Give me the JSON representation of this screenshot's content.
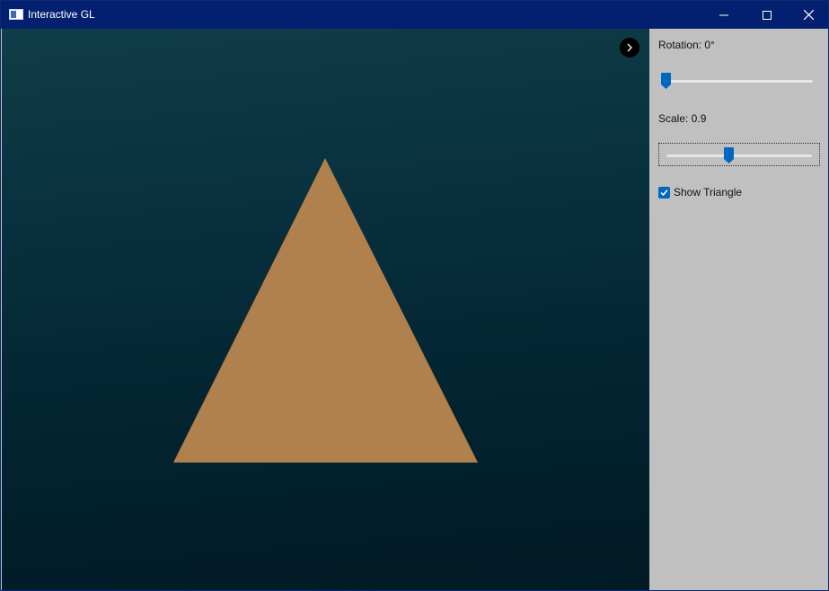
{
  "window": {
    "title": "Interactive GL",
    "title_bar_color": "#032070"
  },
  "titlebar_buttons": {
    "minimize_icon": "minimize-icon",
    "maximize_icon": "maximize-icon",
    "close_icon": "close-icon"
  },
  "viewport": {
    "triangle_color": "#b0804d",
    "expand_icon": "chevron-right-icon"
  },
  "panel": {
    "rotation_label": "Rotation: 0°",
    "rotation_value": 0,
    "rotation_range": [
      0,
      360
    ],
    "scale_label": "Scale: 0.9",
    "scale_value": 0.9,
    "scale_range": [
      0.1,
      2.0
    ],
    "show_triangle_label": "Show Triangle",
    "show_triangle_checked": true,
    "accent_color": "#0067c0"
  }
}
